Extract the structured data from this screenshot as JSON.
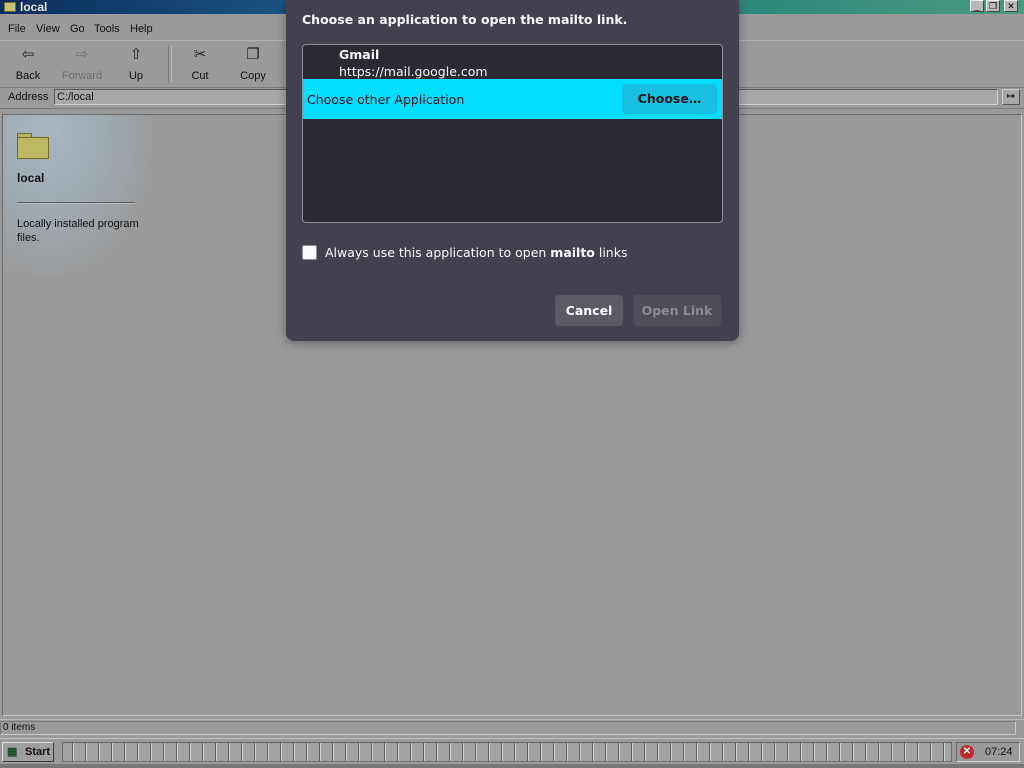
{
  "window": {
    "title": "local",
    "controls": {
      "minimize": "_",
      "restore": "❐",
      "close": "✕"
    }
  },
  "menu": [
    "File",
    "View",
    "Go",
    "Tools",
    "Help"
  ],
  "toolbar": {
    "back": "Back",
    "forward": "Forward",
    "up": "Up",
    "cut": "Cut",
    "copy": "Copy"
  },
  "address": {
    "label": "Address",
    "value": "C:/local",
    "go": "↦"
  },
  "content": {
    "folder_name": "local",
    "folder_description": "Locally installed program files."
  },
  "status": {
    "text": "0 items"
  },
  "taskbar": {
    "start_label": "Start",
    "clock": "07:24",
    "tray_icon": "error-icon"
  },
  "dialog": {
    "title": "Choose an application to open the mailto link.",
    "app": {
      "name": "Gmail",
      "url": "https://mail.google.com"
    },
    "other_label": "Choose other Application",
    "choose_button": "Choose…",
    "always_prefix": "Always use this application to open ",
    "always_bold": "mailto",
    "always_suffix": " links",
    "always_checked": false,
    "cancel": "Cancel",
    "open_link": "Open Link",
    "accent_color": "#00ddff",
    "background_color": "#42414d"
  }
}
